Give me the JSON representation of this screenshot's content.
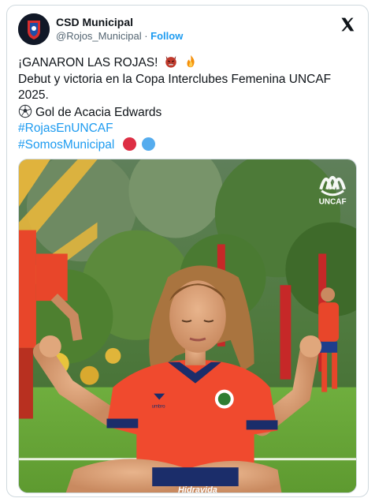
{
  "account": {
    "display_name": "CSD Municipal",
    "handle": "@Rojos_Municipal",
    "separator": "·",
    "follow_label": "Follow"
  },
  "tweet": {
    "line1": "¡GANARON LAS ROJAS!",
    "line2": "Debut y victoria en la Copa Interclubes Femenina UNCAF 2025.",
    "line3": "Gol de Acacia Edwards",
    "hashtag1": "#RojasEnUNCAF",
    "hashtag2": "#SomosMunicipal",
    "emojis": [
      "devil-face",
      "fire",
      "soccer-ball",
      "red-circle",
      "blue-circle"
    ]
  },
  "media": {
    "watermark_text": "UNCAF",
    "shirt_sponsor": "Hidravida",
    "shirt_brand": "umbro"
  },
  "colors": {
    "link": "#1d9bf0",
    "muted": "#536471",
    "red_circle": "#dd2e44",
    "blue_circle": "#55acee",
    "jersey": "#f04a2e"
  }
}
